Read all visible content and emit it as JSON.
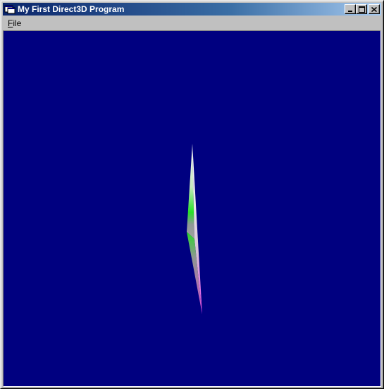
{
  "window": {
    "title": "My First Direct3D Program",
    "app_icon": "window-app-icon",
    "controls": [
      "minimize-icon",
      "maximize-icon",
      "close-icon"
    ]
  },
  "menubar": {
    "items": [
      {
        "label_accel": "F",
        "label_rest": "ile"
      }
    ]
  },
  "viewport": {
    "background": "#000080",
    "colors": {
      "white": "#f0f0f0",
      "green": "#30e040",
      "magenta": "#e040e0",
      "gray": "#a0a0a0"
    }
  }
}
